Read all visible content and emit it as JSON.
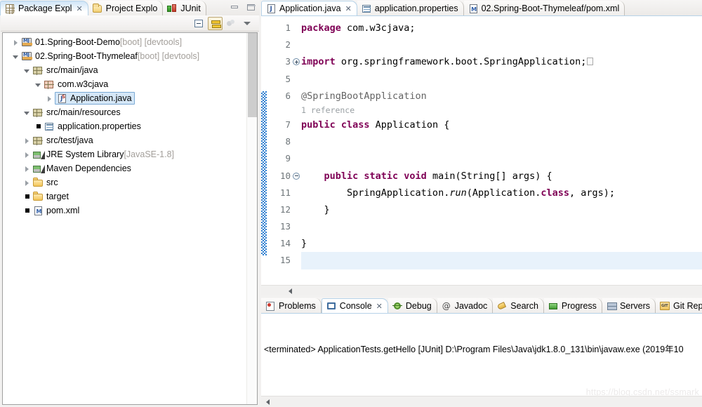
{
  "left_view": {
    "tabs": [
      {
        "label": "Package Expl",
        "icon": "package-explorer-icon",
        "active": true,
        "close": "✕"
      },
      {
        "label": "Project Explo",
        "icon": "project-explorer-icon",
        "active": false
      },
      {
        "label": "JUnit",
        "icon": "junit-icon",
        "active": false
      }
    ],
    "window_buttons": [
      {
        "name": "minimize-button",
        "label": "Minimize"
      },
      {
        "name": "maximize-button",
        "label": "Maximize"
      }
    ],
    "toolbar": [
      {
        "name": "collapse-all-button",
        "label": "Collapse All",
        "pressed": false
      },
      {
        "name": "link-with-editor-button",
        "label": "Link with Editor",
        "pressed": true
      },
      {
        "name": "focus-on-active-task-button",
        "label": "Focus on Active Task",
        "pressed": false
      },
      {
        "name": "view-menu-button",
        "label": "View Menu",
        "pressed": false
      }
    ],
    "tree": [
      {
        "indent": 0,
        "arrow": "closed",
        "icon": "java-project-icon",
        "label": "01.Spring-Boot-Demo",
        "dim": " [boot] [devtools]",
        "selected": false
      },
      {
        "indent": 0,
        "arrow": "open",
        "icon": "java-project-icon",
        "label": "02.Spring-Boot-Thymeleaf",
        "dim": " [boot] [devtools]",
        "selected": false
      },
      {
        "indent": 1,
        "arrow": "open",
        "icon": "source-folder-icon",
        "label": "src/main/java",
        "dim": "",
        "selected": false
      },
      {
        "indent": 2,
        "arrow": "open",
        "icon": "package-icon",
        "label": "com.w3cjava",
        "dim": "",
        "selected": false
      },
      {
        "indent": 3,
        "arrow": "closed",
        "icon": "java-class-icon",
        "label": "Application.java",
        "dim": "",
        "selected": true
      },
      {
        "indent": 1,
        "arrow": "open",
        "icon": "source-folder-icon",
        "label": "src/main/resources",
        "dim": "",
        "selected": false
      },
      {
        "indent": 2,
        "arrow": "none",
        "icon": "properties-file-icon",
        "label": "application.properties",
        "dim": "",
        "selected": false
      },
      {
        "indent": 1,
        "arrow": "closed",
        "icon": "source-folder-icon",
        "label": "src/test/java",
        "dim": "",
        "selected": false
      },
      {
        "indent": 1,
        "arrow": "closed",
        "icon": "library-icon",
        "label": "JRE System Library",
        "dim": " [JavaSE-1.8]",
        "selected": false
      },
      {
        "indent": 1,
        "arrow": "closed",
        "icon": "library-icon",
        "label": "Maven Dependencies",
        "dim": "",
        "selected": false
      },
      {
        "indent": 1,
        "arrow": "closed",
        "icon": "folder-icon",
        "label": "src",
        "dim": "",
        "selected": false
      },
      {
        "indent": 1,
        "arrow": "none",
        "icon": "folder-icon",
        "label": "target",
        "dim": "",
        "selected": false
      },
      {
        "indent": 1,
        "arrow": "none",
        "icon": "xml-file-icon",
        "label": "pom.xml",
        "dim": "",
        "selected": false
      }
    ]
  },
  "editor": {
    "tabs": [
      {
        "label": "Application.java",
        "icon": "java-file-icon",
        "active": true,
        "close": "✕"
      },
      {
        "label": "application.properties",
        "icon": "properties-file-icon",
        "active": false
      },
      {
        "label": "02.Spring-Boot-Thymeleaf/pom.xml",
        "icon": "xml-file-icon",
        "active": false
      }
    ],
    "line_numbers": [
      "1",
      "2",
      "3",
      "5",
      "6",
      "",
      "7",
      "8",
      "9",
      "10",
      "11",
      "12",
      "13",
      "14",
      "15"
    ],
    "folding": [
      "",
      "",
      "plus",
      "",
      "",
      "",
      "",
      "",
      "",
      "minus",
      "",
      "",
      "",
      "",
      ""
    ],
    "cursor_line": 15,
    "code_lines": [
      {
        "n": 1,
        "segments": [
          {
            "t": "package ",
            "c": "kw"
          },
          {
            "t": "com.w3cjava;",
            "c": ""
          }
        ]
      },
      {
        "n": 2,
        "segments": []
      },
      {
        "n": 3,
        "segments": [
          {
            "t": "import ",
            "c": "kw"
          },
          {
            "t": "org.springframework.boot.SpringApplication;",
            "c": ""
          },
          {
            "t": "FOLDBOX",
            "c": "foldbox"
          }
        ]
      },
      {
        "n": 5,
        "segments": []
      },
      {
        "n": 6,
        "segments": [
          {
            "t": "@SpringBootApplication",
            "c": "ann"
          }
        ]
      },
      {
        "n": 0,
        "segments": [
          {
            "t": "1 reference",
            "c": "lens"
          }
        ]
      },
      {
        "n": 7,
        "segments": [
          {
            "t": "public class ",
            "c": "kw"
          },
          {
            "t": "Application {",
            "c": ""
          }
        ]
      },
      {
        "n": 8,
        "segments": []
      },
      {
        "n": 9,
        "segments": []
      },
      {
        "n": 10,
        "segments": [
          {
            "t": "    ",
            "c": ""
          },
          {
            "t": "public static void ",
            "c": "kw"
          },
          {
            "t": "main(String[] args) {",
            "c": ""
          }
        ]
      },
      {
        "n": 11,
        "segments": [
          {
            "t": "        SpringApplication.",
            "c": ""
          },
          {
            "t": "run",
            "c": "ital"
          },
          {
            "t": "(Application.",
            "c": ""
          },
          {
            "t": "class",
            "c": "kw"
          },
          {
            "t": ", args);",
            "c": ""
          }
        ]
      },
      {
        "n": 12,
        "segments": [
          {
            "t": "    }",
            "c": ""
          }
        ]
      },
      {
        "n": 13,
        "segments": []
      },
      {
        "n": 14,
        "segments": [
          {
            "t": "}",
            "c": ""
          }
        ]
      },
      {
        "n": 15,
        "segments": []
      }
    ],
    "change_bar": {
      "from_line_index": 4,
      "to_line_index": 13
    }
  },
  "bottom_view": {
    "tabs": [
      {
        "label": "Problems",
        "icon": "problems-icon",
        "active": false
      },
      {
        "label": "Console",
        "icon": "console-icon",
        "active": true,
        "close": "✕"
      },
      {
        "label": "Debug",
        "icon": "debug-icon",
        "active": false
      },
      {
        "label": "Javadoc",
        "icon": "javadoc-icon",
        "active": false
      },
      {
        "label": "Search",
        "icon": "search-icon",
        "active": false
      },
      {
        "label": "Progress",
        "icon": "progress-icon",
        "active": false
      },
      {
        "label": "Servers",
        "icon": "servers-icon",
        "active": false
      },
      {
        "label": "Git Repo",
        "icon": "git-repositories-icon",
        "active": false
      }
    ],
    "console_text": "<terminated> ApplicationTests.getHello [JUnit] D:\\Program Files\\Java\\jdk1.8.0_131\\bin\\javaw.exe (2019年10"
  },
  "watermark": "https://blog.csdn.net/ssmark",
  "colors": {
    "keyword": "#7f0055",
    "annotation": "#646464",
    "codelens": "#9aa0a4",
    "selection_bg": "#d5e7f7",
    "selection_border": "#7aa9d4",
    "cursor_line_bg": "#e8f2fb",
    "change_bar": "#2f7fd0",
    "dim_text": "#a39f9a",
    "tab_active_border": "#b6d2e8"
  }
}
